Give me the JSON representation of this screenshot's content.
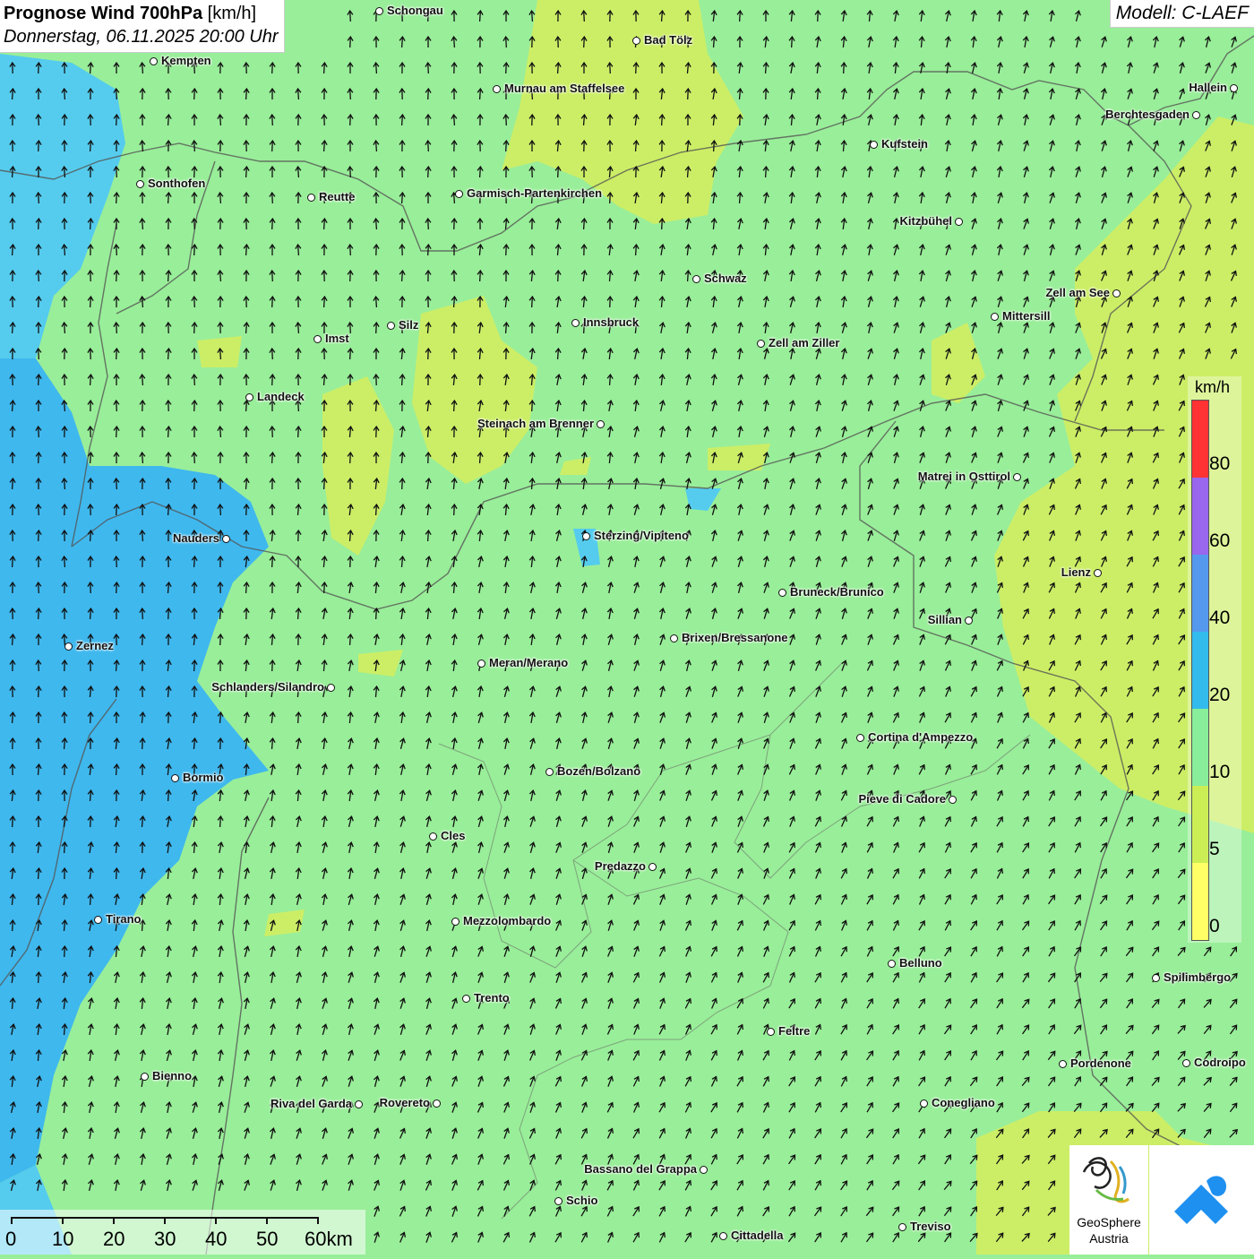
{
  "title": {
    "main": "Prognose Wind 700hPa",
    "unit": "[km/h]",
    "datetime": "Donnerstag, 06.11.2025 20:00 Uhr"
  },
  "model": "Modell: C-LAEF",
  "legend": {
    "unit": "km/h",
    "labels": [
      "80",
      "60",
      "40",
      "20",
      "10",
      "5",
      "0"
    ],
    "colors": [
      "#ff3333",
      "#9966ee",
      "#5599ee",
      "#33bbee",
      "#88ee99",
      "#ccee55",
      "#ffff66"
    ]
  },
  "scale": {
    "labels": [
      "0",
      "10",
      "20",
      "30",
      "40",
      "50",
      "60km"
    ]
  },
  "cities": [
    "Schongau",
    "Bad Tölz",
    "Kempten",
    "Murnau am Staffelsee",
    "Hallein",
    "Berchtesgaden",
    "Kufstein",
    "Sonthofen",
    "Reutte",
    "Garmisch-Partenkirchen",
    "Kitzbühel",
    "Schwaz",
    "Zell am See",
    "Mittersill",
    "Silz",
    "Innsbruck",
    "Imst",
    "Zell am Ziller",
    "Landeck",
    "Steinach am Brenner",
    "Matrei in Osttirol",
    "Nauders",
    "Sterzing/Vipiteno",
    "Lienz",
    "Bruneck/Brunico",
    "Sillian",
    "Zernez",
    "Brixen/Bressanone",
    "Meran/Merano",
    "Schlanders/Silandro",
    "Cortina d'Ampezzo",
    "Bozen/Bolzano",
    "Bormio",
    "Pieve di Cadore",
    "Cles",
    "Predazzo",
    "Tirano",
    "Mezzolombardo",
    "Belluno",
    "Spilimbergo",
    "Trento",
    "Feltre",
    "Pordenone",
    "Codroipo",
    "Bienno",
    "Riva del Garda",
    "Rovereto",
    "Conegliano",
    "Bassano del Grappa",
    "Schio",
    "Treviso",
    "Cittadella"
  ],
  "logos": {
    "geosphere": [
      "GeoSphere",
      "Austria"
    ]
  },
  "map_colors": {
    "green": "#99ee99",
    "yellowgreen": "#ccee66",
    "cyan": "#55ccee",
    "blue": "#33b5ee",
    "arrow": "#111111",
    "border": "#555555"
  }
}
